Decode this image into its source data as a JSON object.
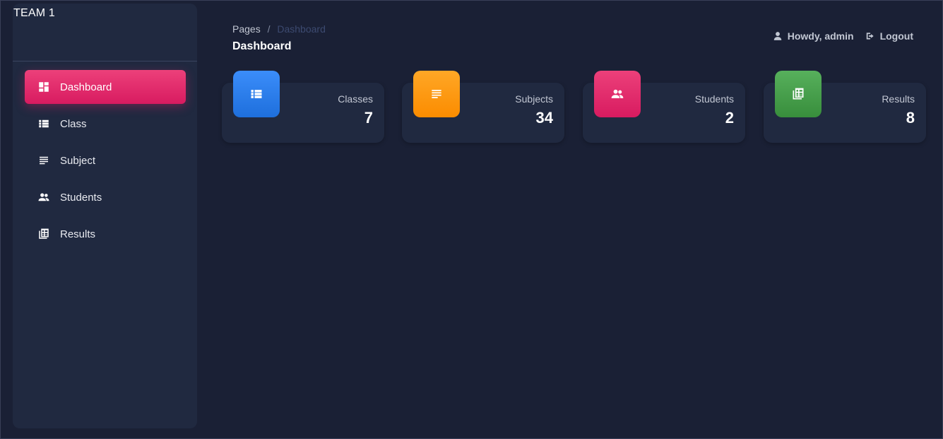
{
  "brand": "TEAM 1",
  "sidebar": {
    "items": [
      {
        "label": "Dashboard",
        "icon": "dashboard-icon",
        "active": true
      },
      {
        "label": "Class",
        "icon": "list-icon",
        "active": false
      },
      {
        "label": "Subject",
        "icon": "subject-icon",
        "active": false
      },
      {
        "label": "Students",
        "icon": "students-icon",
        "active": false
      },
      {
        "label": "Results",
        "icon": "results-icon",
        "active": false
      }
    ]
  },
  "header": {
    "breadcrumb_root": "Pages",
    "breadcrumb_separator": "/",
    "breadcrumb_current": "Dashboard",
    "title": "Dashboard",
    "greeting": "Howdy, admin",
    "logout": "Logout"
  },
  "cards": [
    {
      "label": "Classes",
      "value": "7",
      "icon": "list-icon",
      "color": "#2f80ed"
    },
    {
      "label": "Subjects",
      "value": "34",
      "icon": "subject-icon",
      "color": "#fb8c00"
    },
    {
      "label": "Students",
      "value": "2",
      "icon": "students-icon",
      "color": "#e91e63"
    },
    {
      "label": "Results",
      "value": "8",
      "icon": "results-icon",
      "color": "#43a047"
    }
  ],
  "colors": {
    "background": "#1a2035",
    "panel": "#202940",
    "active": "#e91e63"
  }
}
